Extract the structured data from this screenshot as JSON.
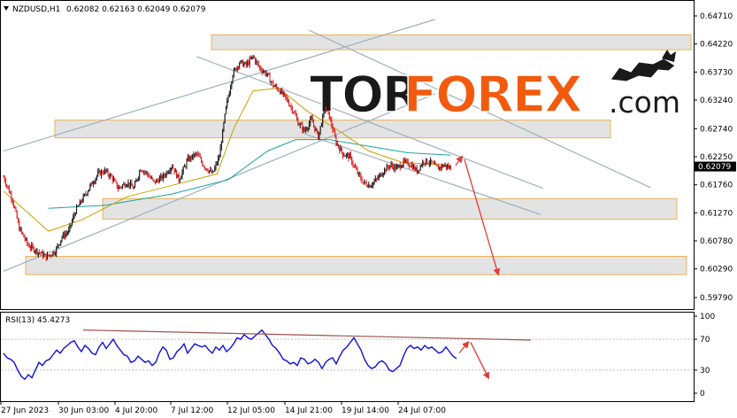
{
  "header": {
    "symbol": "NZDUSD,H1",
    "ohlc": "0.62082 0.62163 0.62049 0.62079"
  },
  "watermark": {
    "part1": "TOR",
    "part2": "FOREX",
    "suffix": ".com"
  },
  "rsi_panel": {
    "label": "RSI(13) 45.4273"
  },
  "colors": {
    "bull": "#1b1b1b",
    "bear": "#e02020",
    "ma_fast": "#c8a000",
    "ma_slow": "#1aa39a",
    "rsi": "#1010d8",
    "zone_fill": "#e2e2e2",
    "zone_border": "#e8b04a",
    "channel": "#9fb0bf",
    "arrow": "#e53a3a",
    "resistance": "#a0524d",
    "brand_dark": "#1a1a1a",
    "brand_orange": "#f25a0e"
  },
  "chart_data": [
    {
      "type": "candlestick",
      "title": "NZDUSD,H1",
      "y_ticks": [
        "0.64710",
        "0.64220",
        "0.63730",
        "0.63240",
        "0.62740",
        "0.62250",
        "0.61760",
        "0.61270",
        "0.60780",
        "0.60290",
        "0.59790"
      ],
      "ylim": [
        0.5979,
        0.6471
      ],
      "current_price": "0.62079",
      "x_ticks": [
        "27 Jun 2023",
        "30 Jun 03:00",
        "4 Jul 20:00",
        "7 Jul 12:00",
        "12 Jul 05:00",
        "14 Jul 21:00",
        "19 Jul 14:00",
        "24 Jul 07:00"
      ],
      "price_path": [
        [
          0,
          0.619
        ],
        [
          8,
          0.615
        ],
        [
          14,
          0.61
        ],
        [
          22,
          0.607
        ],
        [
          30,
          0.606
        ],
        [
          38,
          0.605
        ],
        [
          46,
          0.606
        ],
        [
          52,
          0.6085
        ],
        [
          58,
          0.6095
        ],
        [
          64,
          0.613
        ],
        [
          70,
          0.615
        ],
        [
          76,
          0.617
        ],
        [
          84,
          0.6195
        ],
        [
          90,
          0.62
        ],
        [
          96,
          0.619
        ],
        [
          102,
          0.617
        ],
        [
          110,
          0.618
        ],
        [
          116,
          0.617
        ],
        [
          122,
          0.6205
        ],
        [
          128,
          0.6195
        ],
        [
          134,
          0.618
        ],
        [
          142,
          0.619
        ],
        [
          150,
          0.621
        ],
        [
          156,
          0.6185
        ],
        [
          164,
          0.622
        ],
        [
          172,
          0.623
        ],
        [
          178,
          0.621
        ],
        [
          186,
          0.6195
        ],
        [
          192,
          0.6225
        ],
        [
          198,
          0.631
        ],
        [
          204,
          0.637
        ],
        [
          210,
          0.639
        ],
        [
          216,
          0.6385
        ],
        [
          222,
          0.64
        ],
        [
          228,
          0.638
        ],
        [
          234,
          0.637
        ],
        [
          240,
          0.635
        ],
        [
          246,
          0.634
        ],
        [
          252,
          0.6325
        ],
        [
          258,
          0.6305
        ],
        [
          262,
          0.6285
        ],
        [
          268,
          0.627
        ],
        [
          274,
          0.629
        ],
        [
          280,
          0.626
        ],
        [
          286,
          0.631
        ],
        [
          290,
          0.6295
        ],
        [
          296,
          0.625
        ],
        [
          302,
          0.623
        ],
        [
          308,
          0.6225
        ],
        [
          314,
          0.62
        ],
        [
          320,
          0.618
        ],
        [
          326,
          0.6175
        ],
        [
          332,
          0.6185
        ],
        [
          338,
          0.62
        ],
        [
          344,
          0.621
        ],
        [
          350,
          0.6205
        ],
        [
          356,
          0.6215
        ],
        [
          362,
          0.6212
        ],
        [
          368,
          0.62
        ],
        [
          374,
          0.6218
        ],
        [
          380,
          0.6215
        ],
        [
          386,
          0.6205
        ],
        [
          392,
          0.621
        ],
        [
          398,
          0.6205
        ]
      ],
      "ma_fast": [
        [
          0,
          0.6165
        ],
        [
          40,
          0.6095
        ],
        [
          70,
          0.6115
        ],
        [
          110,
          0.6155
        ],
        [
          150,
          0.6175
        ],
        [
          190,
          0.6195
        ],
        [
          205,
          0.6275
        ],
        [
          222,
          0.634
        ],
        [
          245,
          0.6345
        ],
        [
          270,
          0.6305
        ],
        [
          295,
          0.6275
        ],
        [
          325,
          0.6235
        ],
        [
          355,
          0.6215
        ],
        [
          398,
          0.621
        ]
      ],
      "ma_slow": [
        [
          40,
          0.6135
        ],
        [
          90,
          0.614
        ],
        [
          150,
          0.616
        ],
        [
          200,
          0.6185
        ],
        [
          235,
          0.6235
        ],
        [
          260,
          0.6255
        ],
        [
          290,
          0.6255
        ],
        [
          320,
          0.6245
        ],
        [
          360,
          0.6232
        ],
        [
          398,
          0.6228
        ]
      ],
      "zones": [
        [
          0.6412,
          0.6438
        ],
        [
          0.6258,
          0.6289
        ],
        [
          0.6116,
          0.6152
        ],
        [
          0.6019,
          0.6051
        ]
      ],
      "channels": [
        [
          [
            0,
            0.6025
          ],
          [
            384,
            0.6335
          ]
        ],
        [
          [
            0,
            0.6235
          ],
          [
            384,
            0.6465
          ]
        ],
        [
          [
            172,
            0.64
          ],
          [
            480,
            0.617
          ]
        ],
        [
          [
            272,
            0.6446
          ],
          [
            576,
            0.6171
          ]
        ],
        [
          [
            268,
            0.6265
          ],
          [
            478,
            0.6124
          ]
        ]
      ],
      "forecast": [
        [
          [
            515,
            0.621
          ],
          [
            522,
            0.6225
          ]
        ],
        [
          [
            525,
            0.622
          ],
          [
            563,
            0.602
          ]
        ]
      ]
    },
    {
      "type": "line",
      "title": "RSI(13) 45.4273",
      "y_ticks": [
        "100",
        "70",
        "30",
        "0"
      ],
      "ylim": [
        0,
        100
      ],
      "values": [
        [
          0,
          52
        ],
        [
          4,
          46
        ],
        [
          8,
          44
        ],
        [
          12,
          40
        ],
        [
          16,
          30
        ],
        [
          20,
          22
        ],
        [
          24,
          18
        ],
        [
          28,
          24
        ],
        [
          32,
          20
        ],
        [
          36,
          30
        ],
        [
          40,
          40
        ],
        [
          44,
          36
        ],
        [
          48,
          42
        ],
        [
          52,
          44
        ],
        [
          56,
          50
        ],
        [
          60,
          56
        ],
        [
          64,
          52
        ],
        [
          68,
          58
        ],
        [
          72,
          62
        ],
        [
          76,
          66
        ],
        [
          80,
          68
        ],
        [
          84,
          60
        ],
        [
          88,
          54
        ],
        [
          92,
          62
        ],
        [
          96,
          58
        ],
        [
          100,
          52
        ],
        [
          104,
          50
        ],
        [
          108,
          60
        ],
        [
          112,
          66
        ],
        [
          116,
          58
        ],
        [
          120,
          64
        ],
        [
          124,
          70
        ],
        [
          128,
          62
        ],
        [
          132,
          56
        ],
        [
          136,
          50
        ],
        [
          140,
          48
        ],
        [
          144,
          40
        ],
        [
          148,
          42
        ],
        [
          152,
          48
        ],
        [
          156,
          44
        ],
        [
          160,
          40
        ],
        [
          164,
          42
        ],
        [
          168,
          36
        ],
        [
          172,
          40
        ],
        [
          176,
          52
        ],
        [
          180,
          60
        ],
        [
          184,
          56
        ],
        [
          188,
          44
        ],
        [
          192,
          46
        ],
        [
          196,
          54
        ],
        [
          200,
          58
        ],
        [
          204,
          64
        ],
        [
          208,
          52
        ],
        [
          212,
          58
        ],
        [
          216,
          64
        ],
        [
          220,
          62
        ],
        [
          224,
          60
        ],
        [
          228,
          62
        ],
        [
          232,
          56
        ],
        [
          236,
          52
        ],
        [
          240,
          60
        ],
        [
          244,
          56
        ],
        [
          248,
          62
        ],
        [
          252,
          54
        ],
        [
          256,
          58
        ],
        [
          260,
          64
        ],
        [
          264,
          72
        ],
        [
          268,
          70
        ],
        [
          272,
          76
        ],
        [
          276,
          72
        ],
        [
          280,
          70
        ],
        [
          284,
          74
        ],
        [
          288,
          78
        ],
        [
          292,
          82
        ],
        [
          296,
          76
        ],
        [
          300,
          70
        ],
        [
          304,
          62
        ],
        [
          308,
          58
        ],
        [
          312,
          52
        ],
        [
          316,
          44
        ],
        [
          320,
          42
        ],
        [
          324,
          38
        ],
        [
          328,
          40
        ],
        [
          332,
          36
        ],
        [
          336,
          46
        ],
        [
          340,
          44
        ],
        [
          344,
          38
        ],
        [
          348,
          40
        ],
        [
          352,
          44
        ],
        [
          356,
          40
        ],
        [
          360,
          32
        ],
        [
          364,
          40
        ],
        [
          368,
          44
        ],
        [
          372,
          46
        ],
        [
          376,
          38
        ],
        [
          380,
          48
        ],
        [
          384,
          56
        ],
        [
          388,
          60
        ],
        [
          392,
          66
        ],
        [
          396,
          72
        ],
        [
          400,
          64
        ],
        [
          404,
          56
        ],
        [
          408,
          44
        ],
        [
          412,
          36
        ],
        [
          416,
          32
        ],
        [
          420,
          34
        ],
        [
          424,
          40
        ],
        [
          428,
          42
        ],
        [
          432,
          38
        ],
        [
          436,
          30
        ],
        [
          440,
          28
        ],
        [
          444,
          32
        ],
        [
          448,
          36
        ],
        [
          452,
          48
        ],
        [
          456,
          58
        ],
        [
          460,
          62
        ],
        [
          464,
          58
        ],
        [
          468,
          60
        ],
        [
          472,
          56
        ],
        [
          476,
          62
        ],
        [
          480,
          58
        ],
        [
          484,
          60
        ],
        [
          488,
          56
        ],
        [
          492,
          52
        ],
        [
          496,
          54
        ],
        [
          500,
          60
        ],
        [
          504,
          54
        ],
        [
          508,
          48
        ],
        [
          512,
          45
        ]
      ],
      "resistance": [
        [
          90,
          82
        ],
        [
          596,
          69
        ]
      ],
      "forecast": [
        [
          [
            515,
            52
          ],
          [
            525,
            66
          ]
        ],
        [
          [
            528,
            66
          ],
          [
            548,
            20
          ]
        ]
      ]
    }
  ]
}
